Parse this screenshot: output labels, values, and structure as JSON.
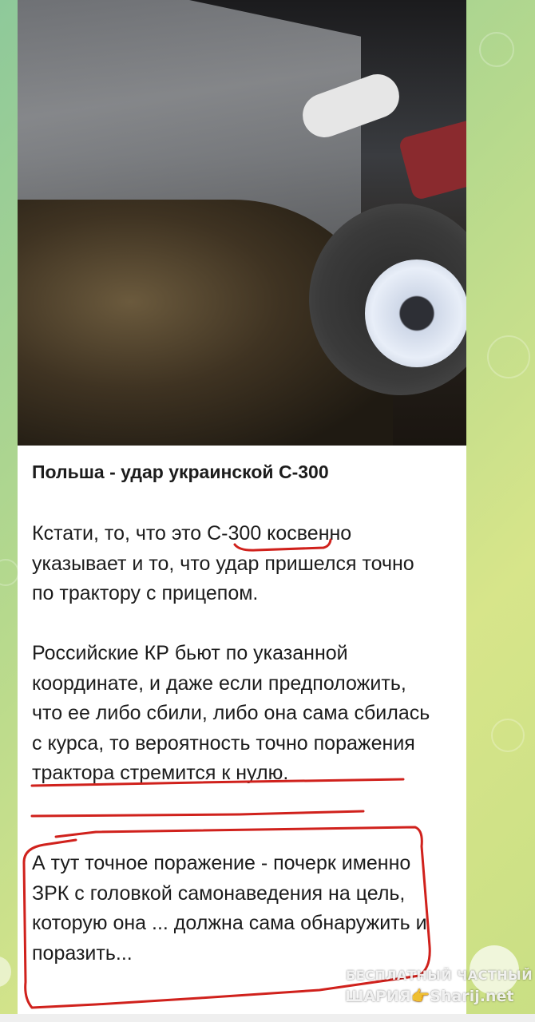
{
  "post": {
    "title": "Польша - удар  украинской С-300",
    "paragraphs": [
      "Кстати, то, что это С-300 косвенно указывает и то, что удар пришелся точно по трактору с прицепом.",
      " Российские КР бьют по указанной координате, и даже если предположить, что ее либо сбили, либо она сама сбилась с курса, то вероятность точно поражения трактора стремится к нулю.",
      " А тут точное поражение - почерк именно ЗРК с головкой самонаведения на цель, которую она ... должна сама обнаружить и поразить..."
    ]
  },
  "watermark": {
    "line1": "БЕСПЛАТНЫЙ ЧАСТНЫЙ",
    "line2": "ШАРИЯ👉Sharij.net"
  },
  "colors": {
    "annotation": "#d0211c",
    "wallpaper_start": "#8ec99a",
    "wallpaper_end": "#d7e58a",
    "text": "#1c1c1c"
  }
}
